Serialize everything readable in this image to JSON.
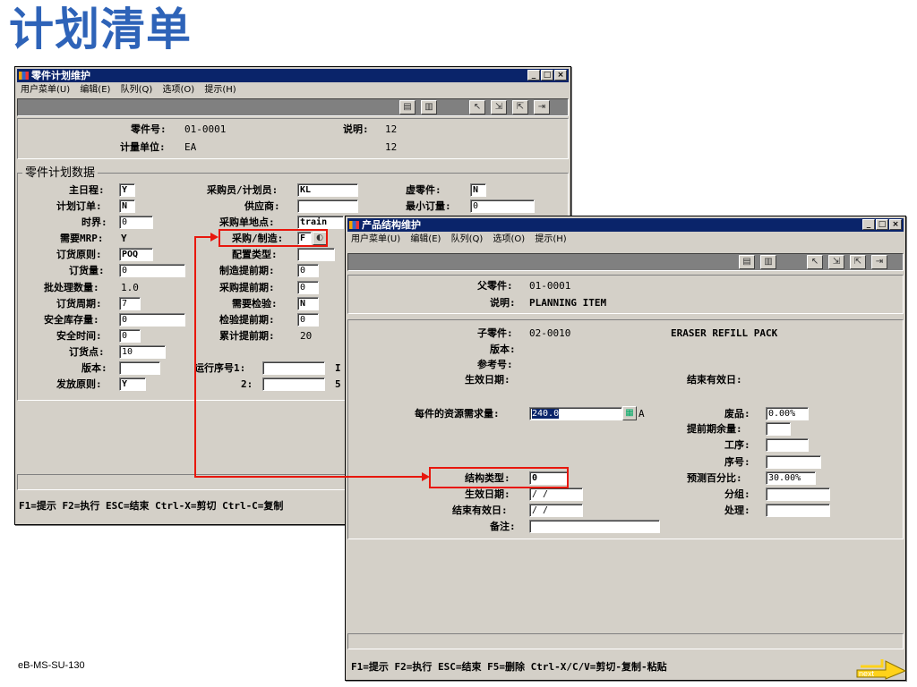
{
  "slide": {
    "title": "计划清单",
    "footer_code": "eB-MS-SU-130",
    "next_label": "next"
  },
  "win1": {
    "title": "零件计划维护",
    "menu": [
      "用户菜单(U)",
      "编辑(E)",
      "队列(Q)",
      "选项(O)",
      "提示(H)"
    ],
    "header": {
      "part_label": "零件号:",
      "part_value": "01-0001",
      "desc_label": "说明:",
      "desc_value": "12",
      "uom_label": "计量单位:",
      "uom_value": "EA",
      "desc2_value": "12"
    },
    "group_title": "零件计划数据",
    "fields": {
      "master_sched": {
        "label": "主日程:",
        "value": "Y"
      },
      "plan_order": {
        "label": "计划订单:",
        "value": "N"
      },
      "time_fence": {
        "label": "时界:",
        "value": "0"
      },
      "mrp_required": {
        "label": "需要MRP:",
        "value": "Y"
      },
      "order_policy": {
        "label": "订货原则:",
        "value": "POQ"
      },
      "order_qty": {
        "label": "订货量:",
        "value": "0"
      },
      "batch_qty": {
        "label": "批处理数量:",
        "value": "1.0"
      },
      "order_period": {
        "label": "订货周期:",
        "value": "7"
      },
      "safety_stock": {
        "label": "安全库存量:",
        "value": "0"
      },
      "safety_time": {
        "label": "安全时间:",
        "value": "0"
      },
      "reorder_point": {
        "label": "订货点:",
        "value": "10"
      },
      "revision": {
        "label": "版本:",
        "value": ""
      },
      "issue_policy": {
        "label": "发放原则:",
        "value": "Y"
      },
      "buyer": {
        "label": "采购员/计划员:",
        "value": "KL"
      },
      "supplier": {
        "label": "供应商:",
        "value": ""
      },
      "purchase_site": {
        "label": "采购单地点:",
        "value": "train"
      },
      "pur_mfg": {
        "label": "采购/制造:",
        "value": "F"
      },
      "config_type": {
        "label": "配置类型:",
        "value": ""
      },
      "mfg_lead": {
        "label": "制造提前期:",
        "value": "0"
      },
      "pur_lead": {
        "label": "采购提前期:",
        "value": "0"
      },
      "inspect_req": {
        "label": "需要检验:",
        "value": "N"
      },
      "inspect_lead": {
        "label": "检验提前期:",
        "value": "0"
      },
      "cum_lead": {
        "label": "累计提前期:",
        "value": "20"
      },
      "routing1": {
        "label": "运行序号1:",
        "value": ""
      },
      "routing2": {
        "label": "2:",
        "value": ""
      },
      "phantom": {
        "label": "虚零件:",
        "value": "N"
      },
      "min_order": {
        "label": "最小订量:",
        "value": "0"
      },
      "trunc1": "I",
      "trunc2": "5"
    },
    "hint": "F1=提示 F2=执行 ESC=结束 Ctrl-X=剪切 Ctrl-C=复制"
  },
  "win2": {
    "title": "产品结构维护",
    "menu": [
      "用户菜单(U)",
      "编辑(E)",
      "队列(Q)",
      "选项(O)",
      "提示(H)"
    ],
    "header": {
      "parent_label": "父零件:",
      "parent_value": "01-0001",
      "desc_label": "说明:",
      "desc_value": "PLANNING ITEM"
    },
    "fields": {
      "child": {
        "label": "子零件:",
        "value": "02-0010"
      },
      "child_desc": "ERASER REFILL PACK",
      "revision": {
        "label": "版本:"
      },
      "reference": {
        "label": "参考号:"
      },
      "start_eff": {
        "label": "生效日期:"
      },
      "end_eff": {
        "label": "结束有效日:"
      },
      "qty_per": {
        "label": "每件的资源需求量:",
        "value": "240.0"
      },
      "qty_trunc": "A",
      "scrap": {
        "label": "废品:",
        "value": "0.00%"
      },
      "lead_offset": {
        "label": "提前期余量:",
        "value": ""
      },
      "operation": {
        "label": "工序:",
        "value": ""
      },
      "sequence": {
        "label": "序号:",
        "value": ""
      },
      "struct_type": {
        "label": "结构类型:",
        "value": "0"
      },
      "forecast_pct": {
        "label": "预测百分比:",
        "value": "30.00%"
      },
      "start_date": {
        "label": "生效日期:",
        "value": " /  /"
      },
      "group": {
        "label": "分组:",
        "value": ""
      },
      "end_date": {
        "label": "结束有效日:",
        "value": " /  /"
      },
      "process": {
        "label": "处理:",
        "value": ""
      },
      "remarks": {
        "label": "备注:",
        "value": ""
      }
    },
    "hint": "F1=提示 F2=执行 ESC=结束 F5=删除 Ctrl-X/C/V=剪切-复制-粘贴"
  },
  "colors": {
    "title_blue": "#2e63b8",
    "window_face": "#d4d0c8",
    "titlebar": "#0a246a",
    "highlight_red": "#e8170d"
  }
}
